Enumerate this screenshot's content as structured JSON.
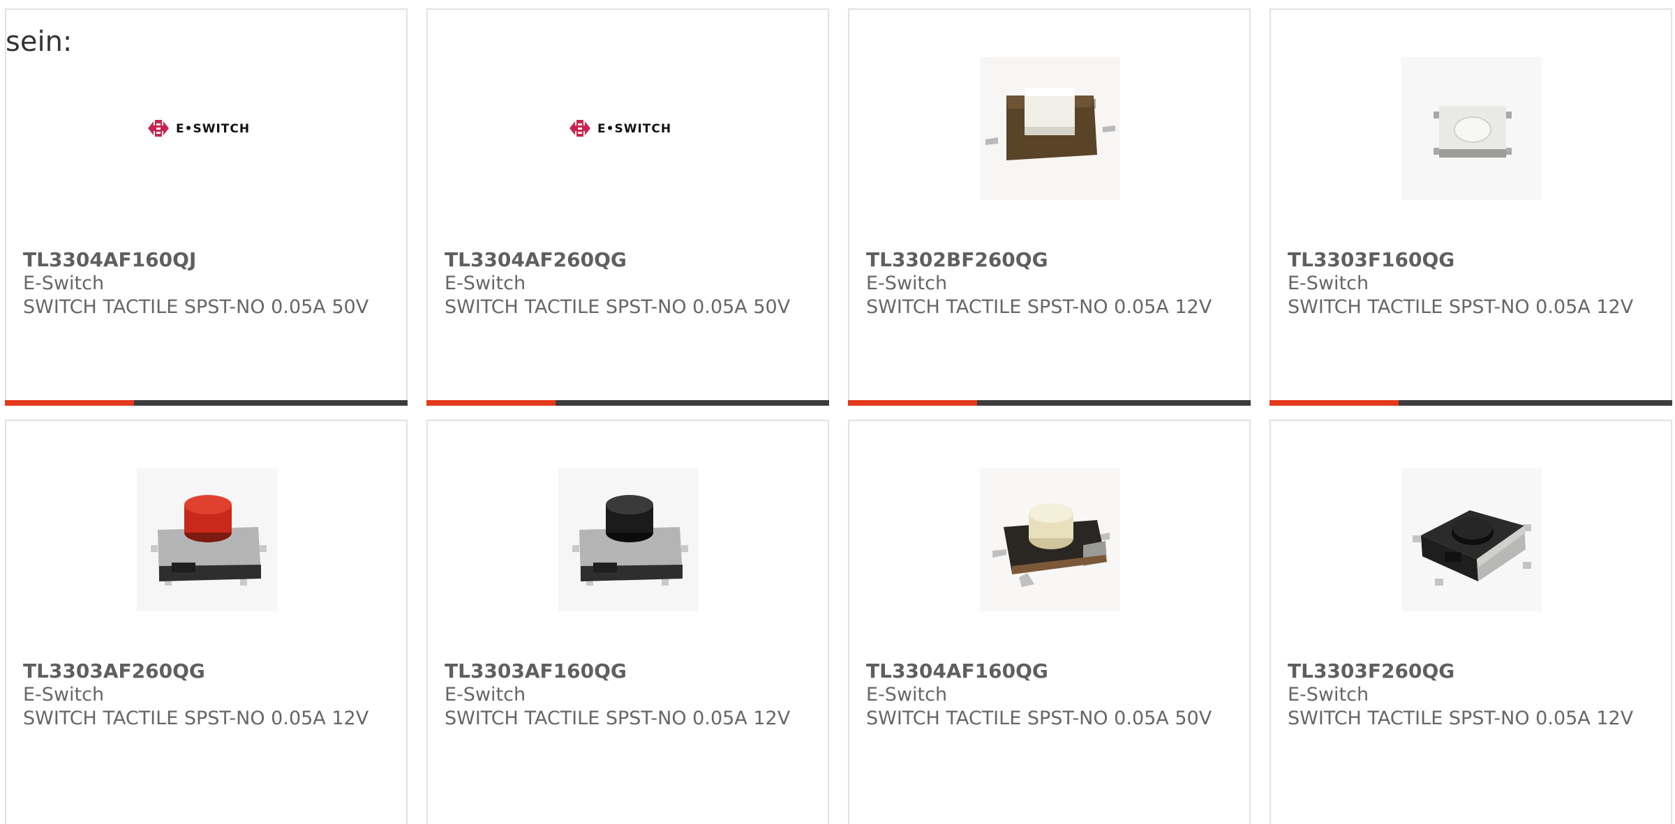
{
  "intro_text": "sein:",
  "accent_color": "#e4391b",
  "bar_color": "#3c3c3c",
  "logo_text": "E•SWITCH",
  "products": [
    {
      "part_number": "TL3304AF160QJ",
      "manufacturer": "E-Switch",
      "description": "SWITCH TACTILE SPST-NO 0.05A 50V",
      "image": "e-switch-logo"
    },
    {
      "part_number": "TL3304AF260QG",
      "manufacturer": "E-Switch",
      "description": "SWITCH TACTILE SPST-NO 0.05A 50V",
      "image": "e-switch-logo"
    },
    {
      "part_number": "TL3302BF260QG",
      "manufacturer": "E-Switch",
      "description": "SWITCH TACTILE SPST-NO 0.05A 12V",
      "image": "brown-smd-switch"
    },
    {
      "part_number": "TL3303F160QG",
      "manufacturer": "E-Switch",
      "description": "SWITCH TACTILE SPST-NO 0.05A 12V",
      "image": "white-smd-switch"
    },
    {
      "part_number": "TL3303AF260QG",
      "manufacturer": "E-Switch",
      "description": "SWITCH TACTILE SPST-NO 0.05A 12V",
      "image": "red-button-switch"
    },
    {
      "part_number": "TL3303AF160QG",
      "manufacturer": "E-Switch",
      "description": "SWITCH TACTILE SPST-NO 0.05A 12V",
      "image": "black-button-switch"
    },
    {
      "part_number": "TL3304AF160QG",
      "manufacturer": "E-Switch",
      "description": "SWITCH TACTILE SPST-NO 0.05A 50V",
      "image": "cream-button-switch"
    },
    {
      "part_number": "TL3303F260QG",
      "manufacturer": "E-Switch",
      "description": "SWITCH TACTILE SPST-NO 0.05A 12V",
      "image": "black-flat-switch"
    }
  ]
}
